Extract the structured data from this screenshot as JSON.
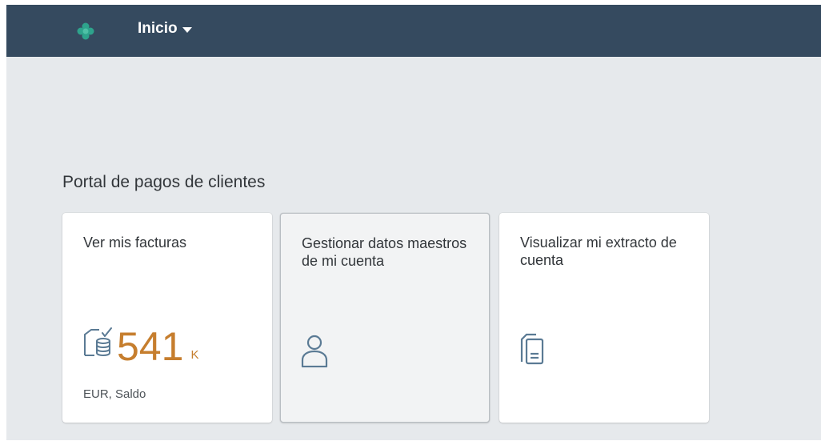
{
  "shellbar": {
    "title": "Inicio",
    "logo_icon": "company-logo-icon",
    "menu_icon": "caret-down-icon",
    "background": "#354a5f"
  },
  "page": {
    "section_title": "Portal de pagos de clientes"
  },
  "tiles": [
    {
      "title": "Ver mis facturas",
      "kpi_value": "541",
      "kpi_scale": "K",
      "footer": "EUR, Saldo",
      "icon": "invoice-stack-icon",
      "kpi_color": "#c67e2e"
    },
    {
      "title": "Gestionar datos maestros de mi cuenta",
      "icon": "person-icon"
    },
    {
      "title": "Visualizar mi extracto de cuenta",
      "icon": "documents-icon"
    }
  ]
}
